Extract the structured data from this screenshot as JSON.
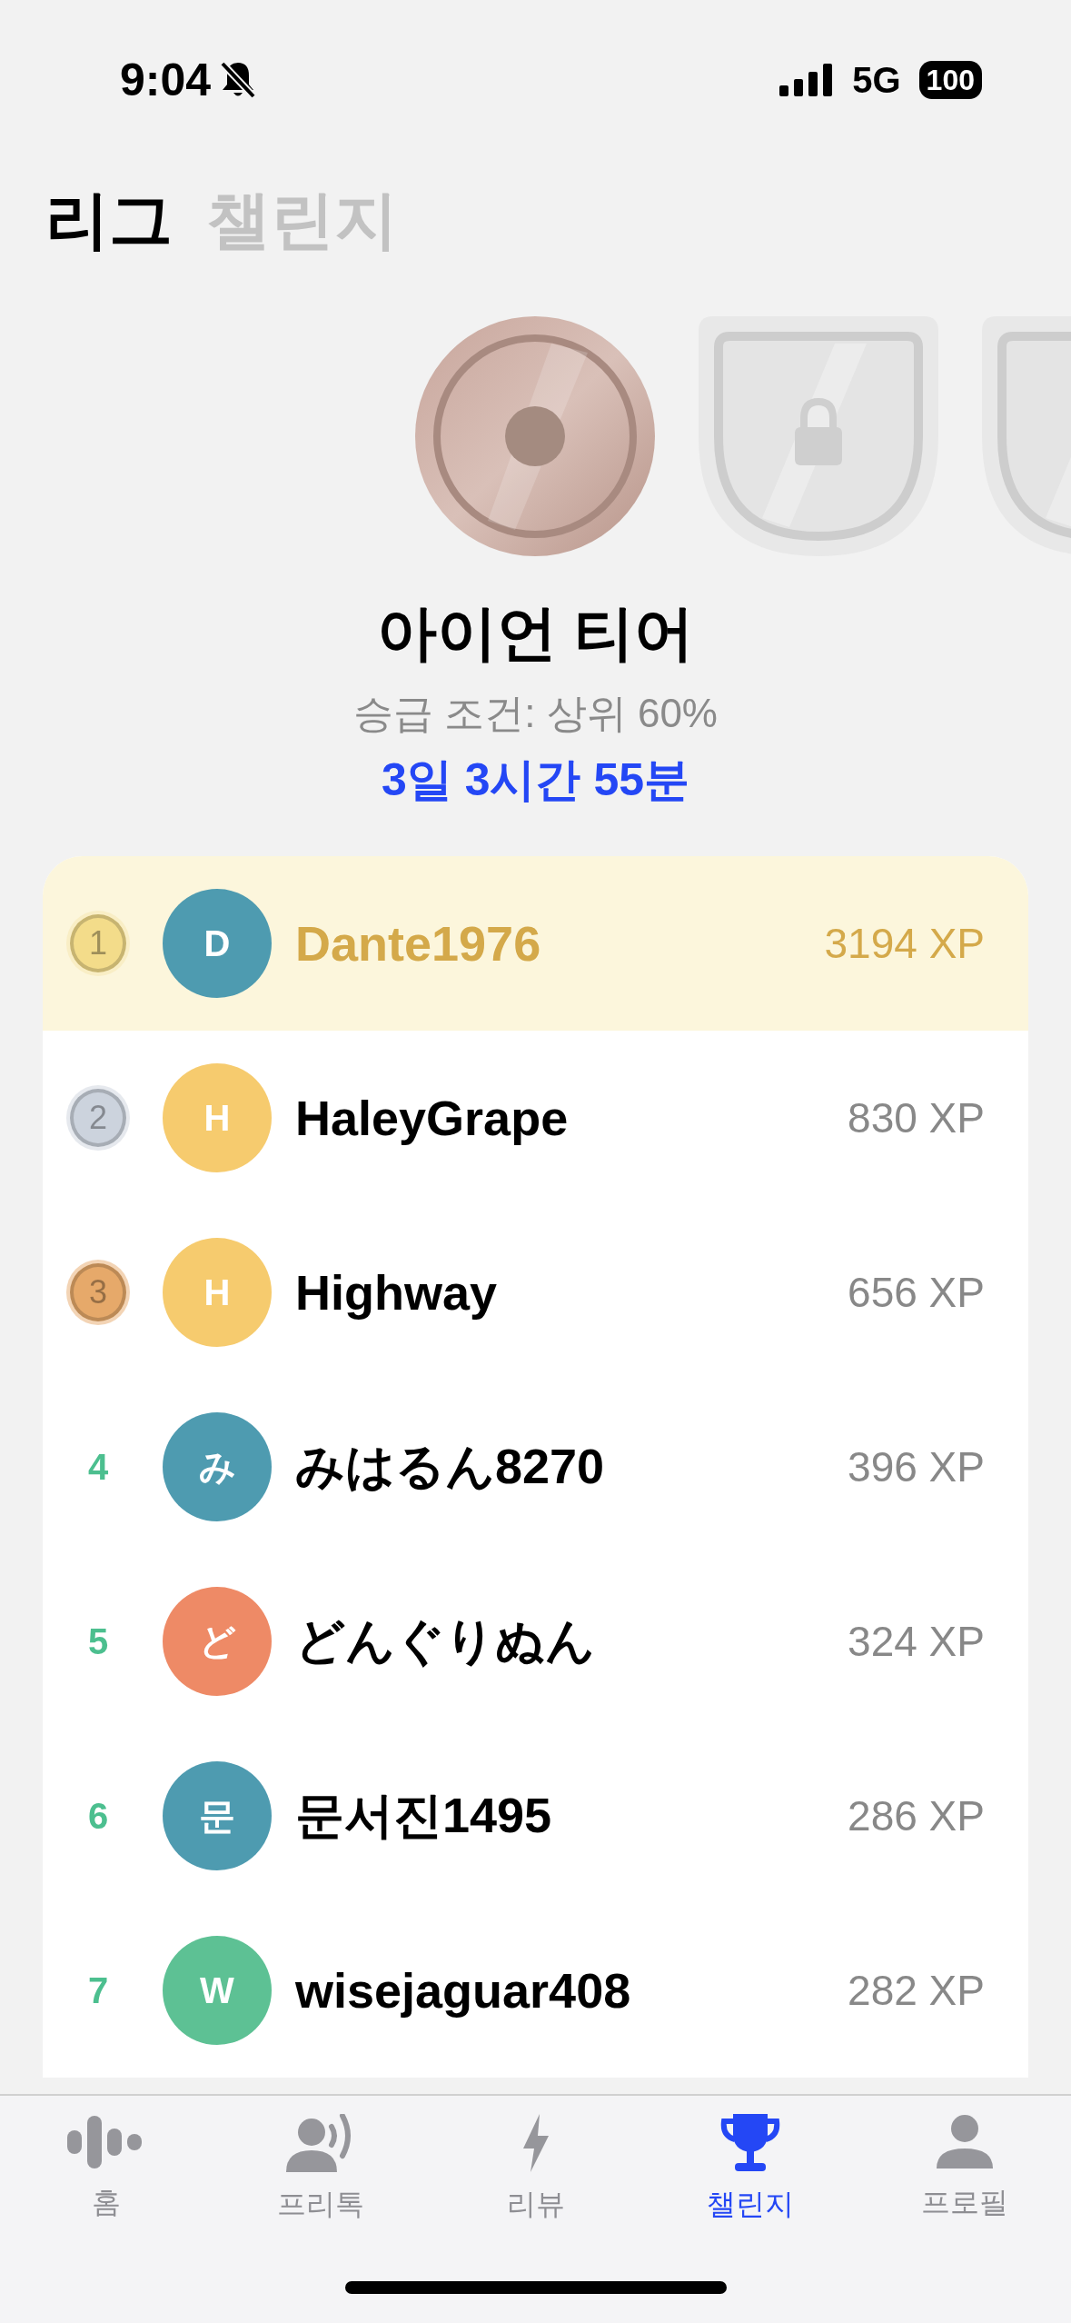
{
  "status_bar": {
    "time": "9:04",
    "silent": true,
    "network": "5G",
    "battery": "100"
  },
  "tabs": [
    {
      "label": "리그",
      "selected": true
    },
    {
      "label": "챌린지",
      "selected": false
    }
  ],
  "badges": [
    {
      "kind": "coin"
    },
    {
      "kind": "locked-shield"
    },
    {
      "kind": "locked-shield"
    }
  ],
  "tier": {
    "name": "아이언 티어",
    "condition": "승급 조건: 상위 60%",
    "countdown": "3일 3시간 55분"
  },
  "leaderboard": [
    {
      "rank": "1",
      "kind": "medal",
      "color": "#f3dc8a",
      "avatar": {
        "letter": "D",
        "color": "#4e9bb0"
      },
      "name": "Dante1976",
      "xp": "3194 XP",
      "highlighted": true
    },
    {
      "rank": "2",
      "kind": "medal",
      "color": "#ccd3dd",
      "avatar": {
        "letter": "H",
        "color": "#f6cb6e"
      },
      "name": "HaleyGrape",
      "xp": "830 XP",
      "highlighted": false
    },
    {
      "rank": "3",
      "kind": "medal",
      "color": "#e6a96a",
      "avatar": {
        "letter": "H",
        "color": "#f6cb6e"
      },
      "name": "Highway",
      "xp": "656 XP",
      "highlighted": false
    },
    {
      "rank": "4",
      "kind": "number",
      "avatar": {
        "letter": "み",
        "color": "#4e9bb0"
      },
      "name": "みはるん8270",
      "xp": "396 XP",
      "highlighted": false
    },
    {
      "rank": "5",
      "kind": "number",
      "avatar": {
        "letter": "ど",
        "color": "#ee8a66"
      },
      "name": "どんぐりぬん",
      "xp": "324 XP",
      "highlighted": false
    },
    {
      "rank": "6",
      "kind": "number",
      "avatar": {
        "letter": "문",
        "color": "#4e9bb0"
      },
      "name": "문서진1495",
      "xp": "286 XP",
      "highlighted": false
    },
    {
      "rank": "7",
      "kind": "number",
      "avatar": {
        "letter": "W",
        "color": "#5dc194"
      },
      "name": "wisejaguar408",
      "xp": "282 XP",
      "highlighted": false
    }
  ],
  "nav": [
    {
      "label": "홈",
      "kind": "home",
      "selected": false
    },
    {
      "label": "프리톡",
      "kind": "talk",
      "selected": false
    },
    {
      "label": "리뷰",
      "kind": "review",
      "selected": false
    },
    {
      "label": "챌린지",
      "kind": "challenge",
      "selected": true
    },
    {
      "label": "프로필",
      "kind": "profile",
      "selected": false
    }
  ]
}
